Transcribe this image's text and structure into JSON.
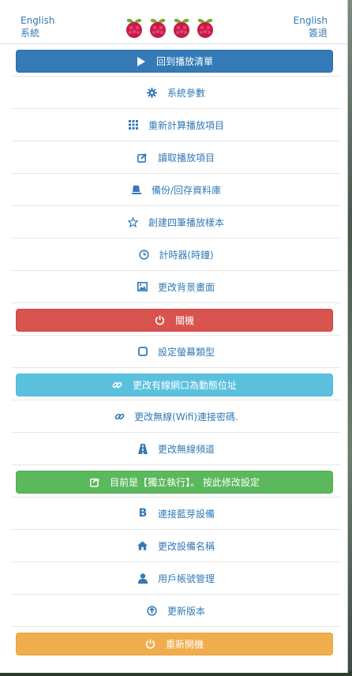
{
  "header": {
    "left_lang": "English",
    "left_label": "系統",
    "right_lang": "English",
    "right_label": "簽退",
    "logo": "raspberry-pi-logo"
  },
  "menu": [
    {
      "label": "回到播放清單",
      "icon": "play-icon",
      "style": "primary",
      "color": "#337ab7"
    },
    {
      "label": "系統參數",
      "icon": "gear-icon",
      "style": "link"
    },
    {
      "label": "重新計算播放項目",
      "icon": "grid-icon",
      "style": "link"
    },
    {
      "label": "讀取播放項目",
      "icon": "edit-icon",
      "style": "link"
    },
    {
      "label": "備份/回存資料庫",
      "icon": "database-icon",
      "style": "link"
    },
    {
      "label": "創建四筆播放樣本",
      "icon": "star-icon",
      "style": "link"
    },
    {
      "label": "計時器(時鐘)",
      "icon": "clock-icon",
      "style": "link"
    },
    {
      "label": "更改背景畫面",
      "icon": "picture-icon",
      "style": "link"
    },
    {
      "label": "關機",
      "icon": "power-icon",
      "style": "danger",
      "color": "#d9534f"
    },
    {
      "label": "設定螢幕類型",
      "icon": "square-icon",
      "style": "link"
    },
    {
      "label": "更改有線網口為動態位址",
      "icon": "link-icon",
      "style": "info",
      "color": "#5bc0de"
    },
    {
      "label": "更改無線(Wifi)連接密碼.",
      "icon": "link-icon",
      "style": "link"
    },
    {
      "label": "更改無線頻道",
      "icon": "road-icon",
      "style": "link"
    },
    {
      "label": "目前是【獨立執行】。 按此修改設定",
      "icon": "share-icon",
      "style": "success",
      "color": "#5cb85c"
    },
    {
      "label": "連接藍芽設備",
      "icon": "bold-b-icon",
      "style": "link"
    },
    {
      "label": "更改設備名稱",
      "icon": "home-icon",
      "style": "link"
    },
    {
      "label": "用戶帳號管理",
      "icon": "user-icon",
      "style": "link"
    },
    {
      "label": "更新版本",
      "icon": "upload-icon",
      "style": "link"
    },
    {
      "label": "重新開機",
      "icon": "power-icon",
      "style": "warning",
      "color": "#f0ad4e"
    }
  ]
}
